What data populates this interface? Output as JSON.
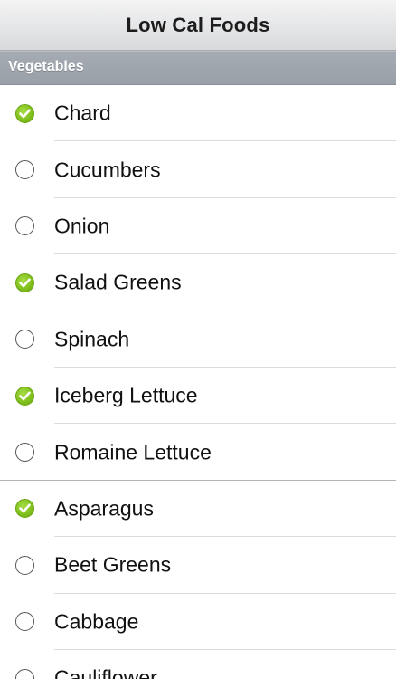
{
  "nav": {
    "title": "Low Cal Foods"
  },
  "section": {
    "title": "Vegetables"
  },
  "items": [
    {
      "label": "Chard",
      "checked": true
    },
    {
      "label": "Cucumbers",
      "checked": false
    },
    {
      "label": "Onion",
      "checked": false
    },
    {
      "label": "Salad Greens",
      "checked": true
    },
    {
      "label": "Spinach",
      "checked": false
    },
    {
      "label": "Iceberg Lettuce",
      "checked": true
    },
    {
      "label": "Romaine Lettuce",
      "checked": false
    },
    {
      "label": "Asparagus",
      "checked": true
    },
    {
      "label": "Beet Greens",
      "checked": false
    },
    {
      "label": "Cabbage",
      "checked": false
    },
    {
      "label": "Cauliflower",
      "checked": false
    }
  ],
  "colors": {
    "check_green": "#82c11e",
    "section_bg": "#9ea4ac"
  },
  "icons": {
    "checked": "green-check-circle-icon",
    "unchecked": "empty-circle-icon"
  }
}
